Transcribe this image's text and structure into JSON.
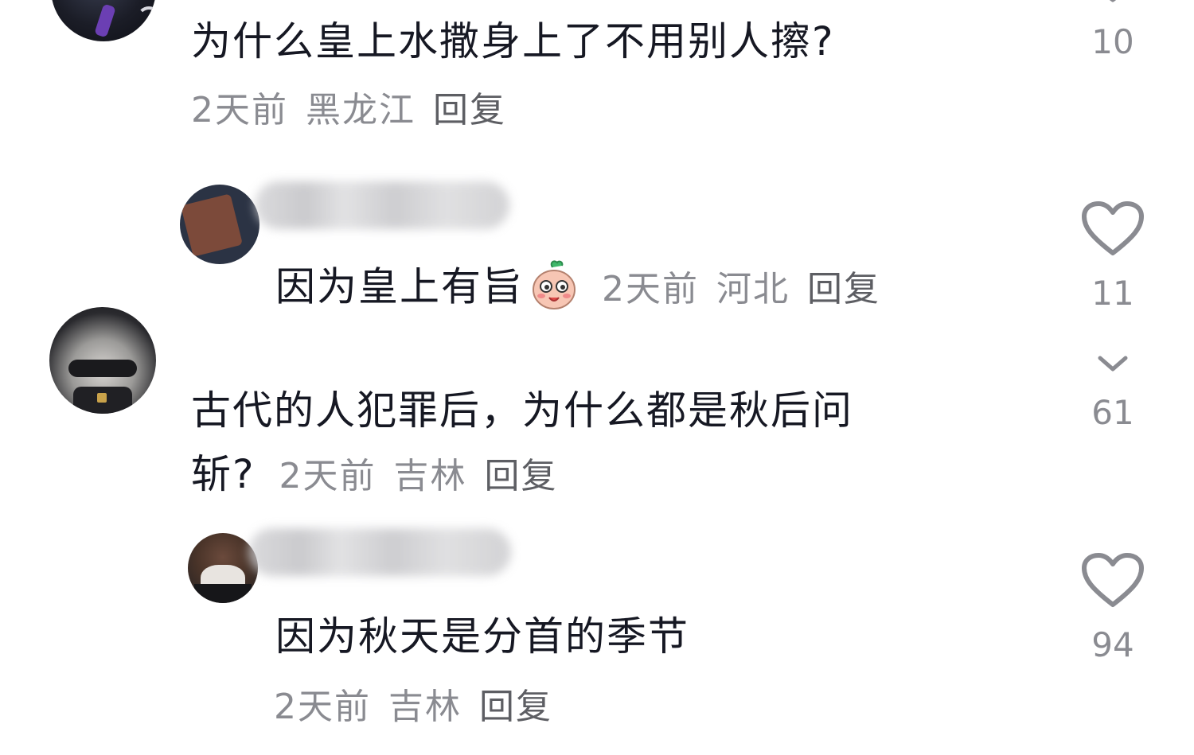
{
  "comments": [
    {
      "text": "为什么皇上水撒身上了不用别人擦?",
      "time": "2天前",
      "location": "黑龙江",
      "reply_label": "回复",
      "likes": "10",
      "icon": "chevron-down-icon"
    },
    {
      "text": "因为皇上有旨",
      "emoji": "blushing-peach-emoji",
      "time": "2天前",
      "location": "河北",
      "reply_label": "回复",
      "likes": "11",
      "icon": "heart-icon"
    },
    {
      "text_line1": "古代的人犯罪后，为什么都是秋后问",
      "text_line2": "斩?",
      "time": "2天前",
      "location": "吉林",
      "reply_label": "回复",
      "likes": "61",
      "icon": "chevron-down-icon"
    },
    {
      "text": "因为秋天是分首的季节",
      "time": "2天前",
      "location": "吉林",
      "reply_label": "回复",
      "likes": "94",
      "icon": "heart-icon"
    }
  ],
  "colors": {
    "text_primary": "#161823",
    "text_secondary": "#8a8b91",
    "icon_stroke": "#8a8b91"
  }
}
